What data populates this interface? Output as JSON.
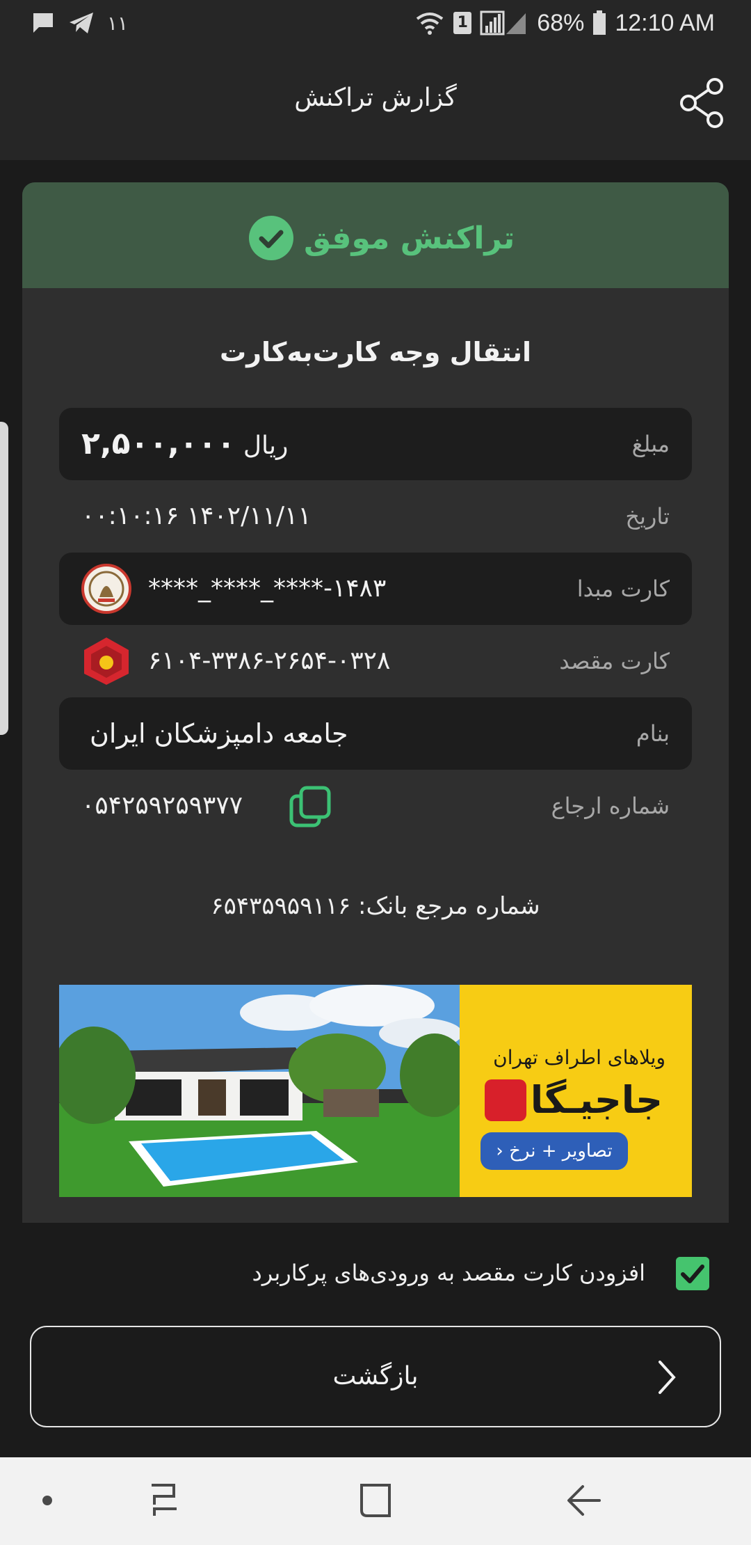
{
  "status_bar": {
    "left_number": "۱۱",
    "battery_percent": "68%",
    "time": "12:10 AM",
    "wifi_badge": "1",
    "icons": [
      "message-icon",
      "telegram-icon",
      "wifi-icon",
      "signal-icon",
      "battery-icon"
    ]
  },
  "app_bar": {
    "title": "گزارش تراکنش",
    "share_icon": "share-icon"
  },
  "status": {
    "text": "تراکنش موفق",
    "color": "#58c27c",
    "icon": "check-circle-icon"
  },
  "transaction": {
    "title": "انتقال وجه کارت‌به‌کارت",
    "rows": [
      {
        "label": "مبلغ",
        "value": "۲,۵۰۰,۰۰۰",
        "unit": "ریال"
      },
      {
        "label": "تاریخ",
        "value": "۱۴۰۲/۱۱/۱۱ ۰۰:۱۰:۱۶"
      },
      {
        "label": "کارت مبدا",
        "value": "****_****_****-۱۴۸۳",
        "bank_icon": "bank-saderat-logo-icon"
      },
      {
        "label": "کارت مقصد",
        "value": "۶۱۰۴-۳۳۸۶-۲۶۵۴-۰۳۲۸",
        "bank_icon": "bank-mellat-logo-icon"
      },
      {
        "label": "بنام",
        "value": "جامعه دامپزشکان ایران"
      },
      {
        "label": "شماره ارجاع",
        "value": "۰۵۴۲۵۹۲۵۹۳۷۷",
        "copy_icon": "copy-icon"
      }
    ],
    "bank_reference": "شماره مرجع بانک: ۶۵۴۳۵۹۵۹۱۱۶"
  },
  "ad": {
    "title": "ویلاهای اطراف تهران",
    "brand": "جاجیـگا",
    "cta": "تصاویر + نرخ"
  },
  "checkbox": {
    "label": "افزودن کارت مقصد به ورودی‌های پرکاربرد",
    "checked": true,
    "color": "#45c46e"
  },
  "back_button": {
    "label": "بازگشت"
  },
  "nav_bar": {
    "icons": [
      "dot-icon",
      "recents-icon",
      "home-icon",
      "back-arrow-icon"
    ]
  }
}
